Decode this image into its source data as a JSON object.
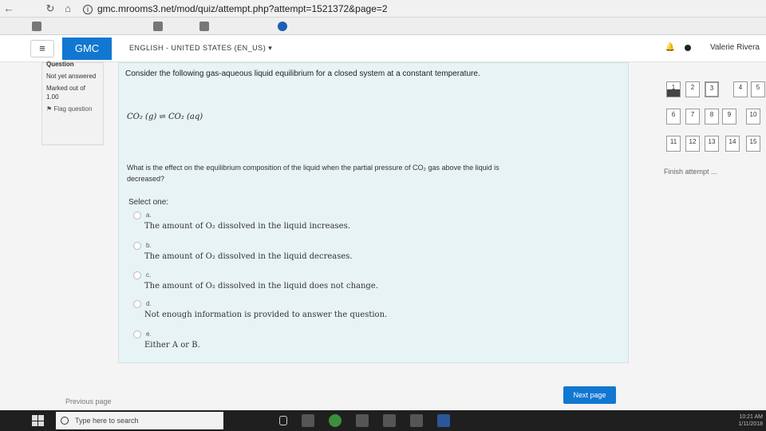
{
  "browser": {
    "url": "gmc.mrooms3.net/mod/quiz/attempt.php?attempt=1521372&page=2",
    "bookmarks": [
      "",
      "",
      "",
      ""
    ]
  },
  "navbar": {
    "brand": "GMC",
    "language": "ENGLISH ‎- UNITED STATES ‎(EN_US)‎",
    "user": "Valerie Rivera"
  },
  "question_info": {
    "heading": "Question",
    "state": "Not yet answered",
    "mark": "Marked out of 1.00",
    "flag": "Flag question"
  },
  "question": {
    "text": "Consider the following gas-aqueous liquid equilibrium for a closed system at a constant temperature.",
    "equation": "CO₂ (g) ⇌ CO₂ (aq)",
    "prompt": "What is the effect on the equilibrium composition of the liquid when the partial pressure of CO₂ gas above the liquid is decreased?",
    "select_one": "Select one:",
    "options": [
      {
        "letter": "a.",
        "text": "The amount of O₂ dissolved in the liquid increases."
      },
      {
        "letter": "b.",
        "text": "The amount of O₂ dissolved in the liquid decreases."
      },
      {
        "letter": "c.",
        "text": "The amount of O₂ dissolved in the liquid does not change."
      },
      {
        "letter": "d.",
        "text": "Not enough information is provided to answer the question."
      },
      {
        "letter": "e.",
        "text": "Either A or B."
      }
    ]
  },
  "quiz_nav": {
    "numbers": [
      "1",
      "2",
      "3",
      "4",
      "5",
      "6",
      "7",
      "8",
      "9",
      "10",
      "11",
      "12",
      "13",
      "14",
      "15"
    ],
    "finish": "Finish attempt ..."
  },
  "footer": {
    "previous": "Previous page",
    "next": "Next page"
  },
  "taskbar": {
    "search_placeholder": "Type here to search",
    "time": "10:21 AM",
    "date": "1/11/2018"
  }
}
